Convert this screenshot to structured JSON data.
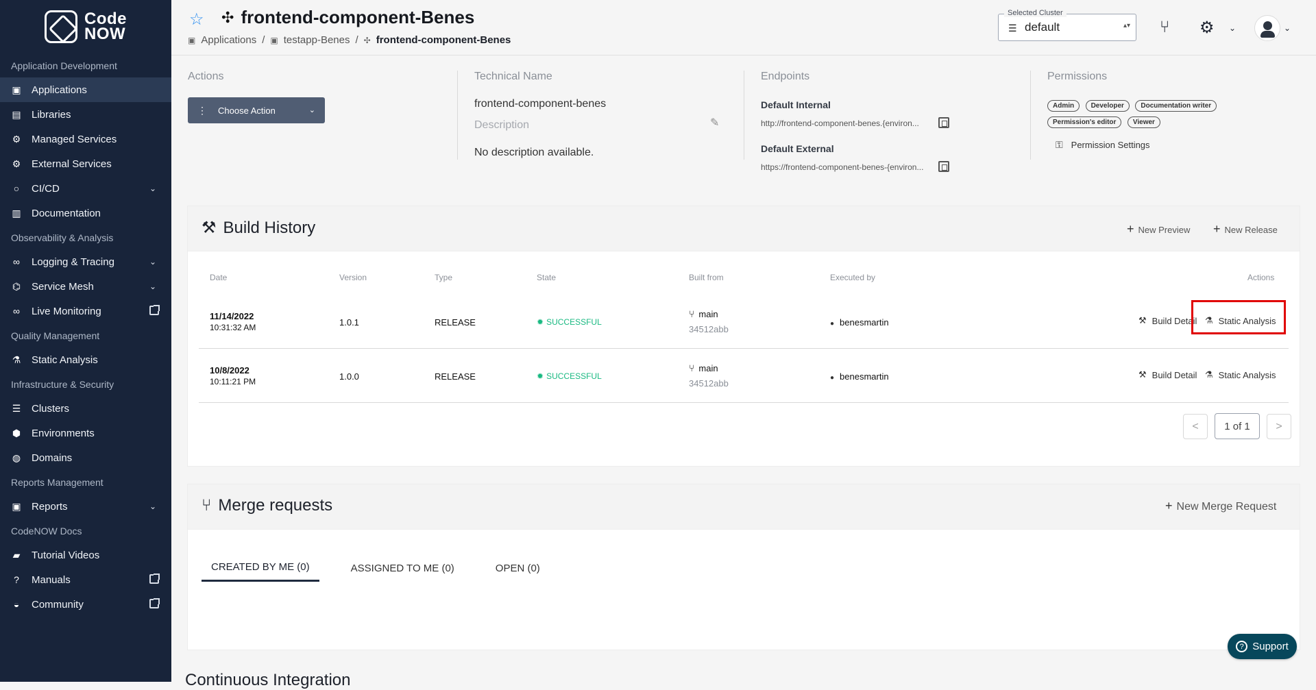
{
  "sidebar": {
    "logo": {
      "text": "Code\nNOW"
    },
    "sections": [
      {
        "title": "Application Development",
        "items": [
          {
            "label": "Applications",
            "icon": "monitor-icon",
            "active": true
          },
          {
            "label": "Libraries",
            "icon": "book-icon"
          },
          {
            "label": "Managed Services",
            "icon": "services-icon"
          },
          {
            "label": "External Services",
            "icon": "external-services-icon"
          },
          {
            "label": "CI/CD",
            "icon": "cycle-icon",
            "expandable": true
          },
          {
            "label": "Documentation",
            "icon": "documentation-icon"
          }
        ]
      },
      {
        "title": "Observability & Analysis",
        "items": [
          {
            "label": "Logging & Tracing",
            "icon": "binoculars-icon",
            "expandable": true
          },
          {
            "label": "Service Mesh",
            "icon": "network-icon",
            "expandable": true
          },
          {
            "label": "Live Monitoring",
            "icon": "binoculars-icon",
            "external": true
          }
        ]
      },
      {
        "title": "Quality Management",
        "items": [
          {
            "label": "Static Analysis",
            "icon": "flask-icon"
          }
        ]
      },
      {
        "title": "Infrastructure & Security",
        "items": [
          {
            "label": "Clusters",
            "icon": "list-icon"
          },
          {
            "label": "Environments",
            "icon": "cube-icon"
          },
          {
            "label": "Domains",
            "icon": "globe-icon"
          }
        ]
      },
      {
        "title": "Reports Management",
        "items": [
          {
            "label": "Reports",
            "icon": "report-icon",
            "expandable": true
          }
        ]
      },
      {
        "title": "CodeNOW Docs",
        "items": [
          {
            "label": "Tutorial Videos",
            "icon": "video-icon"
          },
          {
            "label": "Manuals",
            "icon": "help-icon",
            "external": true
          },
          {
            "label": "Community",
            "icon": "discord-icon",
            "external": true
          }
        ]
      }
    ]
  },
  "header": {
    "title": "frontend-component-Benes",
    "breadcrumbs": [
      "Applications",
      "testapp-Benes",
      "frontend-component-Benes"
    ],
    "cluster": {
      "label": "Selected Cluster",
      "value": "default"
    }
  },
  "overview": {
    "actions": {
      "label": "Actions",
      "button": "Choose Action"
    },
    "technical": {
      "label": "Technical Name",
      "value": "frontend-component-benes",
      "description_label": "Description",
      "description": "No description available."
    },
    "endpoints": {
      "label": "Endpoints",
      "internal_title": "Default Internal",
      "internal_url": "http://frontend-component-benes.{environ...",
      "external_title": "Default External",
      "external_url": "https://frontend-component-benes-{environ..."
    },
    "permissions": {
      "label": "Permissions",
      "roles": [
        "Admin",
        "Developer",
        "Documentation writer",
        "Permission's editor",
        "Viewer"
      ],
      "settings": "Permission Settings"
    }
  },
  "build_history": {
    "title": "Build History",
    "new_preview": "New Preview",
    "new_release": "New Release",
    "columns": [
      "Date",
      "Version",
      "Type",
      "State",
      "Built from",
      "Executed by",
      "Actions"
    ],
    "rows": [
      {
        "date": "11/14/2022",
        "time": "10:31:32 AM",
        "version": "1.0.1",
        "type": "RELEASE",
        "state": "SUCCESSFUL",
        "branch": "main",
        "commit": "34512abb",
        "executed_by": "benesmartin",
        "build_detail": "Build Detail",
        "static_analysis": "Static Analysis"
      },
      {
        "date": "10/8/2022",
        "time": "10:11:21 PM",
        "version": "1.0.0",
        "type": "RELEASE",
        "state": "SUCCESSFUL",
        "branch": "main",
        "commit": "34512abb",
        "executed_by": "benesmartin",
        "build_detail": "Build Detail",
        "static_analysis": "Static Analysis"
      }
    ],
    "pagination": {
      "prev": "<",
      "current": "1 of 1",
      "next": ">"
    }
  },
  "merge_requests": {
    "title": "Merge requests",
    "new_button": "New Merge Request",
    "tabs": [
      "CREATED BY ME (0)",
      "ASSIGNED TO ME (0)",
      "OPEN (0)"
    ]
  },
  "support": "Support",
  "next_card_title": "Continuous Integration",
  "colors": {
    "sidebar": "#18243a",
    "accent": "#2f8ff0",
    "success": "#18b981",
    "highlight": "#e00000",
    "support": "#07475b"
  }
}
